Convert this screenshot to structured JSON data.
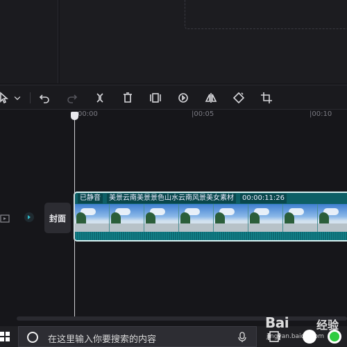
{
  "ruler": {
    "t0": "00:00",
    "t5": "|00:05",
    "t10": "|00:10"
  },
  "toolbar": {
    "tools": [
      "select-pointer",
      "dropdown",
      "undo",
      "redo",
      "split",
      "delete",
      "freeze-frame",
      "reverse-play",
      "mirror",
      "rotate",
      "crop"
    ]
  },
  "track": {
    "cover_label": "封面"
  },
  "clip": {
    "muted_label": "已静音",
    "title": "美景云南美景景色山水云南风景美女素材",
    "duration": "00:00:11:26",
    "thumbnail_count": 8
  },
  "taskbar": {
    "search_placeholder": "在这里输入你要搜索的内容"
  },
  "watermark": {
    "brand": "Bai",
    "brand_cn": "经验",
    "url": "jingyan.baidu.com"
  },
  "colors": {
    "clip_teal": "#0e6a70",
    "accent": "#2fb8c8",
    "background": "#16161a"
  }
}
